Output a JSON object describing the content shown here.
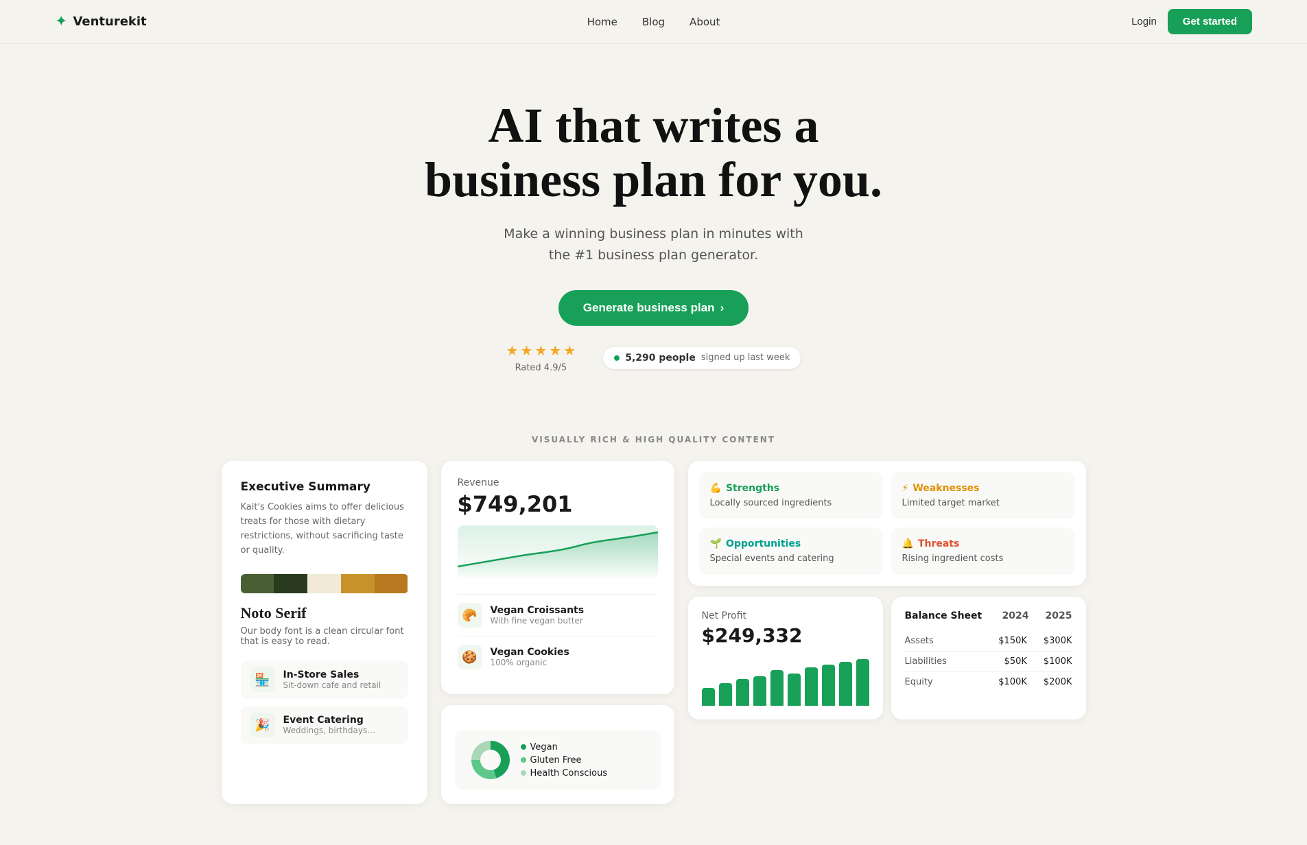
{
  "nav": {
    "logo_text": "Venturekit",
    "links": [
      "Home",
      "Blog",
      "About"
    ],
    "login_label": "Login",
    "get_started_label": "Get started"
  },
  "hero": {
    "headline_line1": "AI that writes a",
    "headline_line2": "business plan for you.",
    "subtitle": "Make a winning business plan in minutes with\nthe #1 business plan generator.",
    "cta_label": "Generate business plan",
    "rating_text": "Rated 4.9/5",
    "signup_count": "5,290 people",
    "signup_sub": "signed up last week"
  },
  "section_label": "VISUALLY RICH & HIGH QUALITY CONTENT",
  "exec_summary": {
    "title": "Executive Summary",
    "text": "Kait's Cookies aims to offer delicious treats for those with dietary restrictions, without sacrificing taste or quality."
  },
  "color_swatches": [
    "#4a5e34",
    "#2a3a1e",
    "#f0ead6",
    "#c8922a",
    "#b87820"
  ],
  "font": {
    "name": "Noto Serif",
    "desc": "Our body font is a clean circular font that is easy to read."
  },
  "channels": [
    {
      "icon": "🏪",
      "name": "In-Store Sales",
      "sub": "Sit-down cafe and retail"
    },
    {
      "icon": "🎉",
      "name": "Event Catering",
      "sub": "Weddings, birthdays..."
    }
  ],
  "revenue": {
    "label": "Revenue",
    "value": "$749,201"
  },
  "products": [
    {
      "icon": "🥐",
      "name": "Vegan Croissants",
      "sub": "With fine vegan butter"
    },
    {
      "icon": "🍪",
      "name": "Vegan Cookies",
      "sub": "100% organic"
    }
  ],
  "donut": {
    "legend": [
      {
        "label": "Vegan",
        "color": "#18a058"
      },
      {
        "label": "Gluten Free",
        "color": "#5dc88a"
      },
      {
        "label": "Health Conscious",
        "color": "#a8d8b8"
      }
    ]
  },
  "swot": {
    "strengths": {
      "title": "Strengths",
      "text": "Locally sourced ingredients"
    },
    "weaknesses": {
      "title": "Weaknesses",
      "text": "Limited target market"
    },
    "opportunities": {
      "title": "Opportunities",
      "text": "Special events and catering"
    },
    "threats": {
      "title": "Threats",
      "text": "Rising ingredient costs"
    }
  },
  "net_profit": {
    "label": "Net Profit",
    "value": "$249,332",
    "bars": [
      30,
      38,
      45,
      50,
      60,
      55,
      65,
      70,
      75,
      80
    ]
  },
  "balance_sheet": {
    "title": "Balance Sheet",
    "years": [
      "2024",
      "2025"
    ],
    "rows": [
      {
        "label": "Assets",
        "val2024": "$150K",
        "val2025": "$300K"
      },
      {
        "label": "Liabilities",
        "val2024": "$50K",
        "val2025": "$100K"
      },
      {
        "label": "Equity",
        "val2024": "$100K",
        "val2025": "$200K"
      }
    ]
  }
}
